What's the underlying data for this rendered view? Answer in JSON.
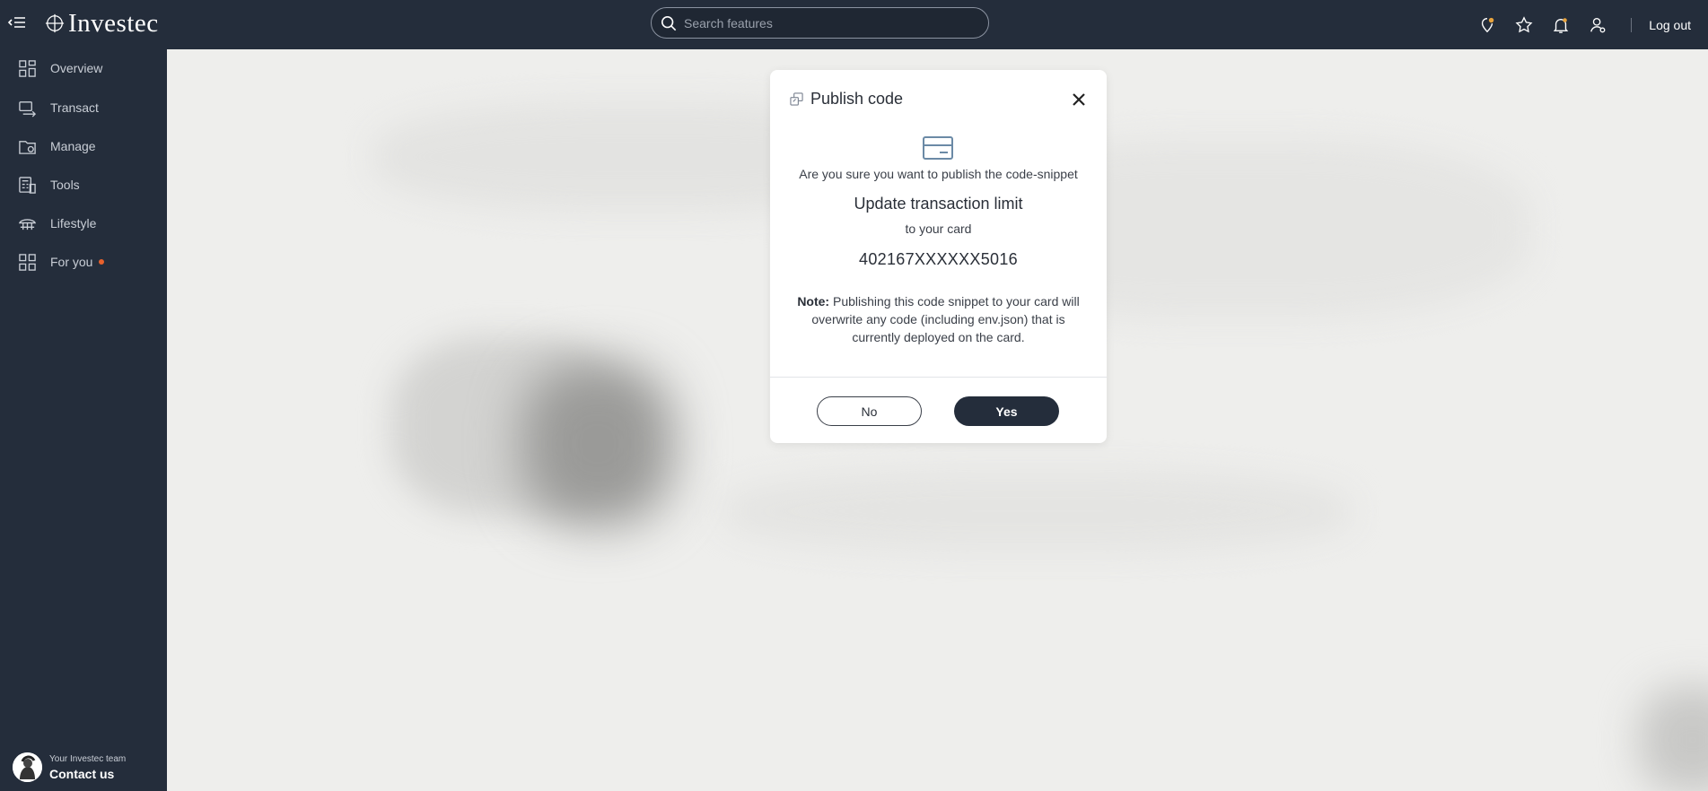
{
  "brand": {
    "name": "Investec"
  },
  "search": {
    "placeholder": "Search features"
  },
  "topbar": {
    "logout_label": "Log out"
  },
  "sidebar": {
    "items": [
      {
        "label": "Overview"
      },
      {
        "label": "Transact"
      },
      {
        "label": "Manage"
      },
      {
        "label": "Tools"
      },
      {
        "label": "Lifestyle"
      },
      {
        "label": "For you"
      }
    ],
    "contact": {
      "team_label": "Your Investec team",
      "link_label": "Contact us"
    }
  },
  "modal": {
    "title": "Publish code",
    "question": "Are you sure you want to publish the code-snippet",
    "snippet_name": "Update transaction limit",
    "to_card": "to your card",
    "card_number": "402167XXXXXX5016",
    "note_label": "Note:",
    "note_text": "Publishing this code snippet to your card will overwrite any code (including env.json) that is currently deployed on the card.",
    "no_label": "No",
    "yes_label": "Yes"
  },
  "colors": {
    "navy": "#242d3b",
    "accent_dot": "#e8612c",
    "background": "#eeeeec"
  }
}
